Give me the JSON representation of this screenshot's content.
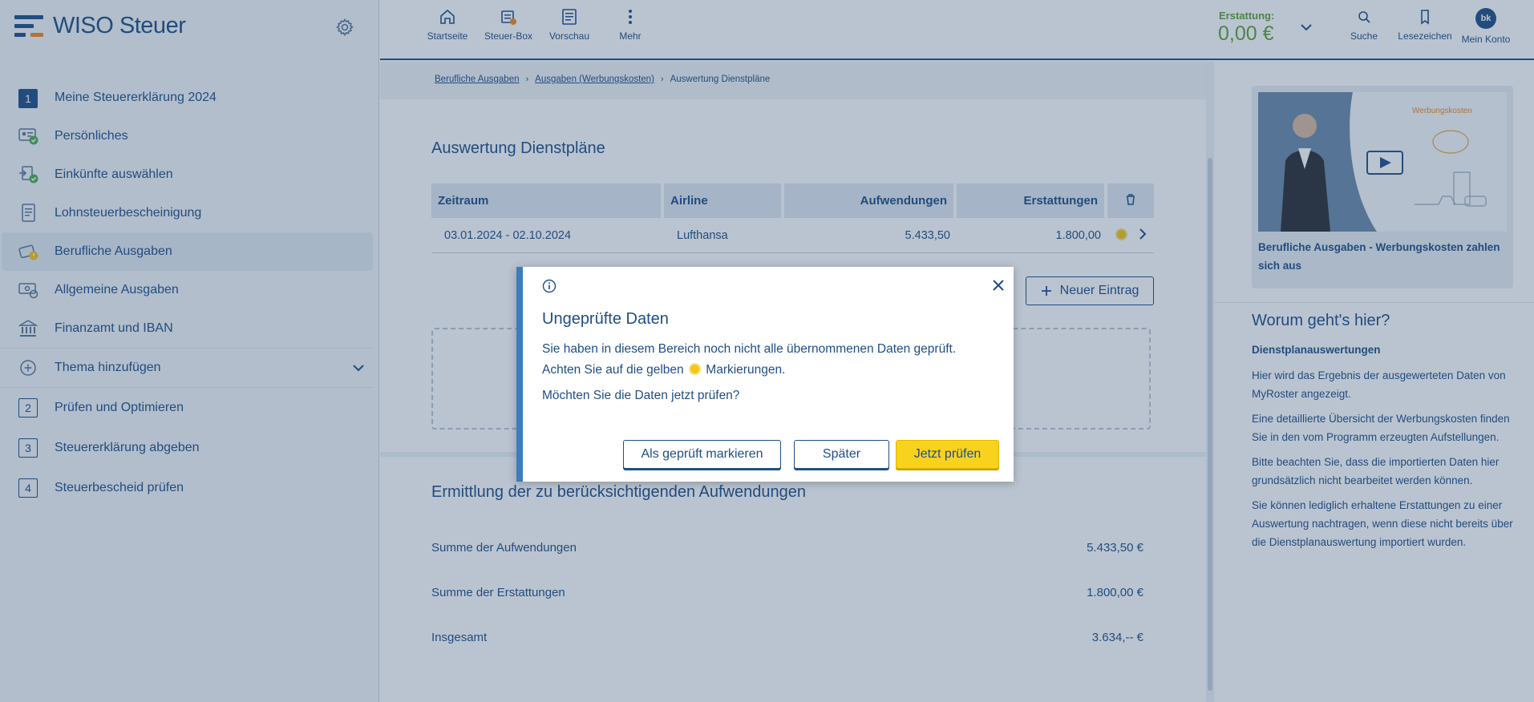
{
  "app": {
    "brand_light": "WISO",
    "brand_bold": "Steuer"
  },
  "sidebar": {
    "items": [
      {
        "label": "Meine Steuererklärung 2024",
        "number": "1"
      },
      {
        "label": "Persönliches"
      },
      {
        "label": "Einkünfte auswählen"
      },
      {
        "label": "Lohnsteuerbescheinigung"
      },
      {
        "label": "Berufliche Ausgaben"
      },
      {
        "label": "Allgemeine Ausgaben"
      },
      {
        "label": "Finanzamt und IBAN"
      },
      {
        "label": "Thema hinzufügen"
      },
      {
        "label": "Prüfen und Optimieren",
        "number": "2"
      },
      {
        "label": "Steuererklärung abgeben",
        "number": "3"
      },
      {
        "label": "Steuerbescheid prüfen",
        "number": "4"
      }
    ]
  },
  "topbar": {
    "home": "Startseite",
    "taxbox": "Steuer-Box",
    "preview": "Vorschau",
    "more": "Mehr",
    "refund_label": "Erstattung:",
    "refund_value": "0,00 €",
    "search": "Suche",
    "bookmarks": "Lesezeichen",
    "account": "Mein Konto",
    "avatar_initials": "bk"
  },
  "breadcrumb": [
    "Berufliche Ausgaben",
    "Ausgaben (Werbungskosten)",
    "Auswertung Dienstpläne"
  ],
  "main": {
    "title": "Auswertung Dienstpläne",
    "table": {
      "headers": [
        "Zeitraum",
        "Airline",
        "Aufwendungen",
        "Erstattungen"
      ],
      "rows": [
        {
          "period": "03.01.2024 - 02.10.2024",
          "airline": "Lufthansa",
          "expenses": "5.433,50",
          "refunds": "1.800,00"
        }
      ]
    },
    "new_entry": "Neuer Eintrag",
    "section2_title": "Ermittlung der zu berücksichtigenden Aufwendungen",
    "sums": [
      {
        "label": "Summe der Aufwendungen",
        "value": "5.433,50 €"
      },
      {
        "label": "Summe der Erstattungen",
        "value": "1.800,00 €"
      },
      {
        "label": "Insgesamt",
        "value": "3.634,-- €"
      }
    ]
  },
  "right": {
    "video_tag": "Werbungskosten",
    "video_caption": "Berufliche Ausgaben - Werbungskosten zahlen sich aus",
    "heading": "Worum geht's hier?",
    "subheading": "Dienstplanauswertungen",
    "paragraphs": [
      "Hier wird das Ergebnis der ausgewerteten Daten von MyRoster angezeigt.",
      "Eine detaillierte Übersicht der Werbungskosten finden Sie in den vom Programm erzeugten Aufstellungen.",
      "Bitte beachten Sie, dass die importierten Daten hier grundsätzlich nicht bearbeitet werden können.",
      "Sie können lediglich erhaltene Erstattungen zu einer Auswertung nachtragen, wenn diese nicht bereits über die Dienstplanauswertung importiert wurden."
    ]
  },
  "dialog": {
    "title": "Ungeprüfte Daten",
    "text_before": "Sie haben in diesem Bereich noch nicht alle übernommenen Daten geprüft. Achten Sie auf die gelben",
    "text_after": "Markierungen.",
    "question": "Möchten Sie die Daten jetzt prüfen?",
    "btn_mark": "Als geprüft markieren",
    "btn_later": "Später",
    "btn_check": "Jetzt prüfen"
  }
}
